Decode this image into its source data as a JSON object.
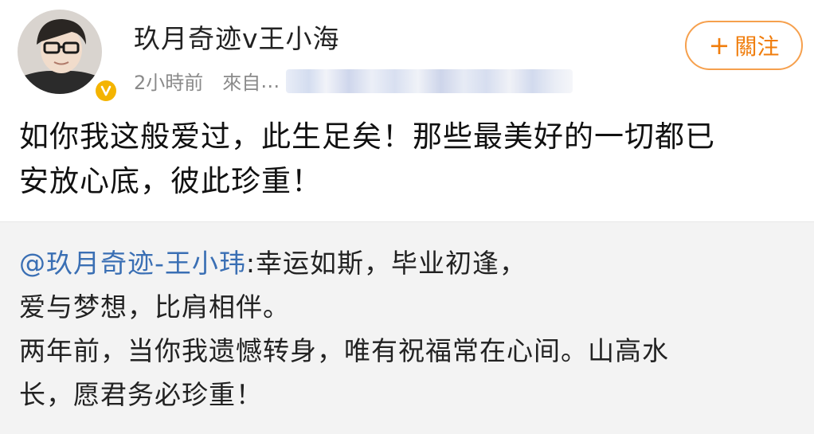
{
  "post": {
    "username": "玖月奇迹v王小海",
    "time": "2小時前",
    "source_label": "來自",
    "source_value_hidden": "…",
    "follow": {
      "icon": "plus-icon",
      "plus": "+",
      "label": "關注"
    },
    "text_line1": "如你我这般爱过，此生足矣！那些最美好的一切都已",
    "text_line2": "安放心底，彼此珍重！",
    "avatar": {
      "icon": "user-avatar-icon",
      "verified_icon": "verified-badge-icon",
      "verified_color": "#f4b400"
    }
  },
  "retweet": {
    "mention": "@玖月奇迹-王小玮",
    "line1_rest": ":幸运如斯，毕业初逢，",
    "line2": "爱与梦想，比肩相伴。",
    "line3": "两年前，当你我遗憾转身，唯有祝福常在心间。山高水",
    "line4": "长，愿君务必珍重！"
  },
  "colors": {
    "accent_orange": "#f07d0c",
    "mention_blue": "#3a6fb4",
    "retweet_bg": "#f3f3f3"
  }
}
